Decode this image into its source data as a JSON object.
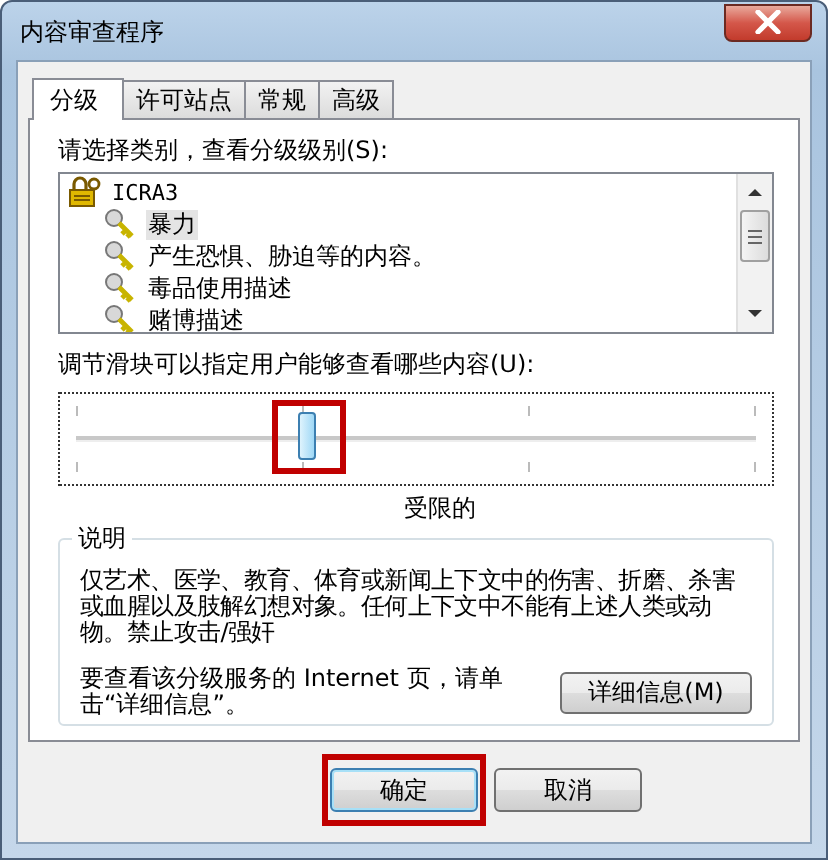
{
  "window": {
    "title": "内容审查程序"
  },
  "tabs": [
    {
      "label": "分级",
      "selected": true
    },
    {
      "label": "许可站点",
      "selected": false
    },
    {
      "label": "常规",
      "selected": false
    },
    {
      "label": "高级",
      "selected": false
    }
  ],
  "category_prompt": "请选择类别，查看分级级别(S):",
  "tree": {
    "label": "ICRA3",
    "children": [
      {
        "label": "暴力",
        "selected": true
      },
      {
        "label": "产生恐惧、胁迫等的内容。",
        "selected": false
      },
      {
        "label": "毒品使用描述",
        "selected": false
      },
      {
        "label": "赌博描述",
        "selected": false
      }
    ]
  },
  "slider": {
    "label": "调节滑块可以指定用户能够查看哪些内容(U):",
    "level": 0.34,
    "highlighted": true,
    "caption": "受限的"
  },
  "description": {
    "title": "说明",
    "text": "仅艺术、医学、教育、体育或新闻上下文中的伤害、折磨、杀害或血腥以及肢解幻想对象。任何上下文中不能有上述人类或动物。禁止攻击/强奸",
    "details_prompt": "要查看该分级服务的 Internet 页，请单击“详细信息”。",
    "details_button": "详细信息(M)"
  },
  "buttons": [
    {
      "label": "确定",
      "highlighted": true
    },
    {
      "label": "取消",
      "highlighted": false
    }
  ]
}
